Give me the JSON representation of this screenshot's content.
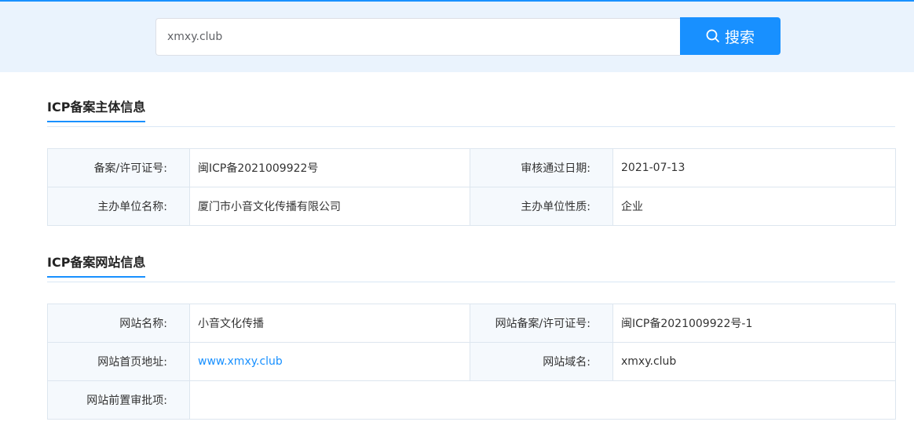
{
  "search": {
    "value": "xmxy.club",
    "button_label": "搜索"
  },
  "colors": {
    "accent": "#1890ff",
    "band_bg": "#eaf3fd",
    "label_bg": "#f5f9fd",
    "border": "#dde6ef"
  },
  "entity_section": {
    "title": "ICP备案主体信息",
    "license_label": "备案/许可证号:",
    "license_value": "闽ICP备2021009922号",
    "approval_date_label": "审核通过日期:",
    "approval_date_value": "2021-07-13",
    "organizer_label": "主办单位名称:",
    "organizer_value": "厦门市小音文化传播有限公司",
    "organizer_type_label": "主办单位性质:",
    "organizer_type_value": "企业"
  },
  "website_section": {
    "title": "ICP备案网站信息",
    "site_name_label": "网站名称:",
    "site_name_value": "小音文化传播",
    "site_license_label": "网站备案/许可证号:",
    "site_license_value": "闽ICP备2021009922号-1",
    "homepage_label": "网站首页地址:",
    "homepage_value": "www.xmxy.club",
    "domain_label": "网站域名:",
    "domain_value": "xmxy.club",
    "preapproval_label": "网站前置审批项:",
    "preapproval_value": ""
  }
}
